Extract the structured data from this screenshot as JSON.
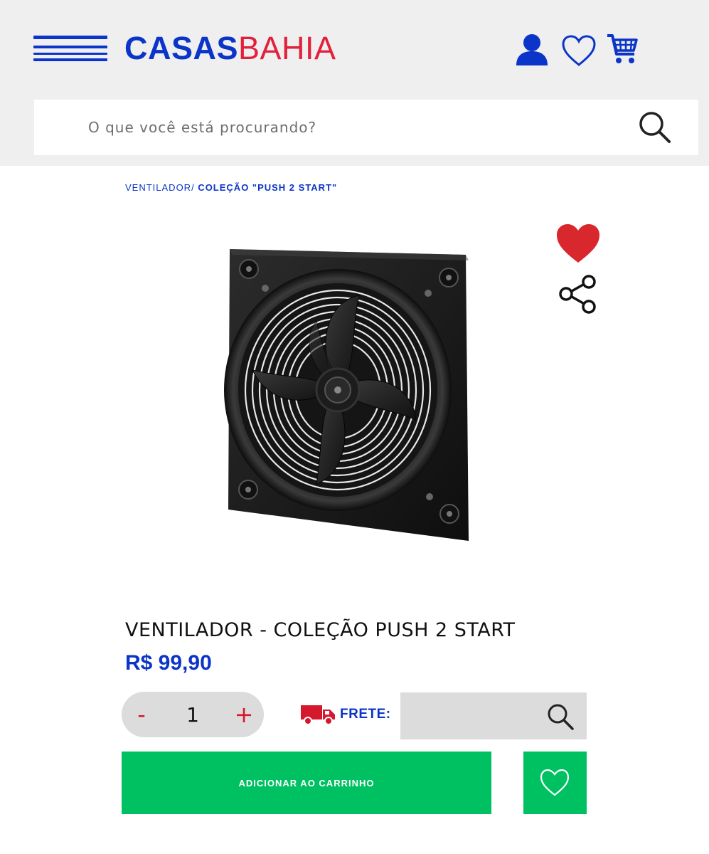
{
  "header": {
    "logo_primary": "CASAS",
    "logo_secondary": "BAHIA",
    "icons": [
      "menu-icon",
      "user-icon",
      "heart-outline-icon",
      "cart-icon"
    ],
    "colors": {
      "brand_blue": "#0b35c8",
      "brand_red": "#e3203b",
      "header_bg": "#efeff0"
    }
  },
  "search": {
    "placeholder": "O que você está procurando?",
    "icon": "search-icon"
  },
  "breadcrumb": {
    "items": [
      "VENTILADOR/",
      " COLEÇÃO \"PUSH 2 START\""
    ]
  },
  "product": {
    "title": "VENTILADOR - COLEÇÃO PUSH 2 START",
    "price": "R$ 99,90",
    "image": "axial-fan-product-photo",
    "favorite_icon": "heart-filled-icon",
    "share_icon": "share-icon"
  },
  "purchase": {
    "minus_label": "-",
    "quantity": "1",
    "plus_label": "+",
    "frete_label": "FRETE:",
    "frete_icon": "truck-icon",
    "add_to_cart_label": "ADICIONAR AO CARRINHO",
    "wishlist_icon": "heart-outline-icon",
    "colors": {
      "cta_green": "#00c161",
      "qty_red": "#d4182d",
      "field_bg": "#dcdcdc"
    }
  }
}
